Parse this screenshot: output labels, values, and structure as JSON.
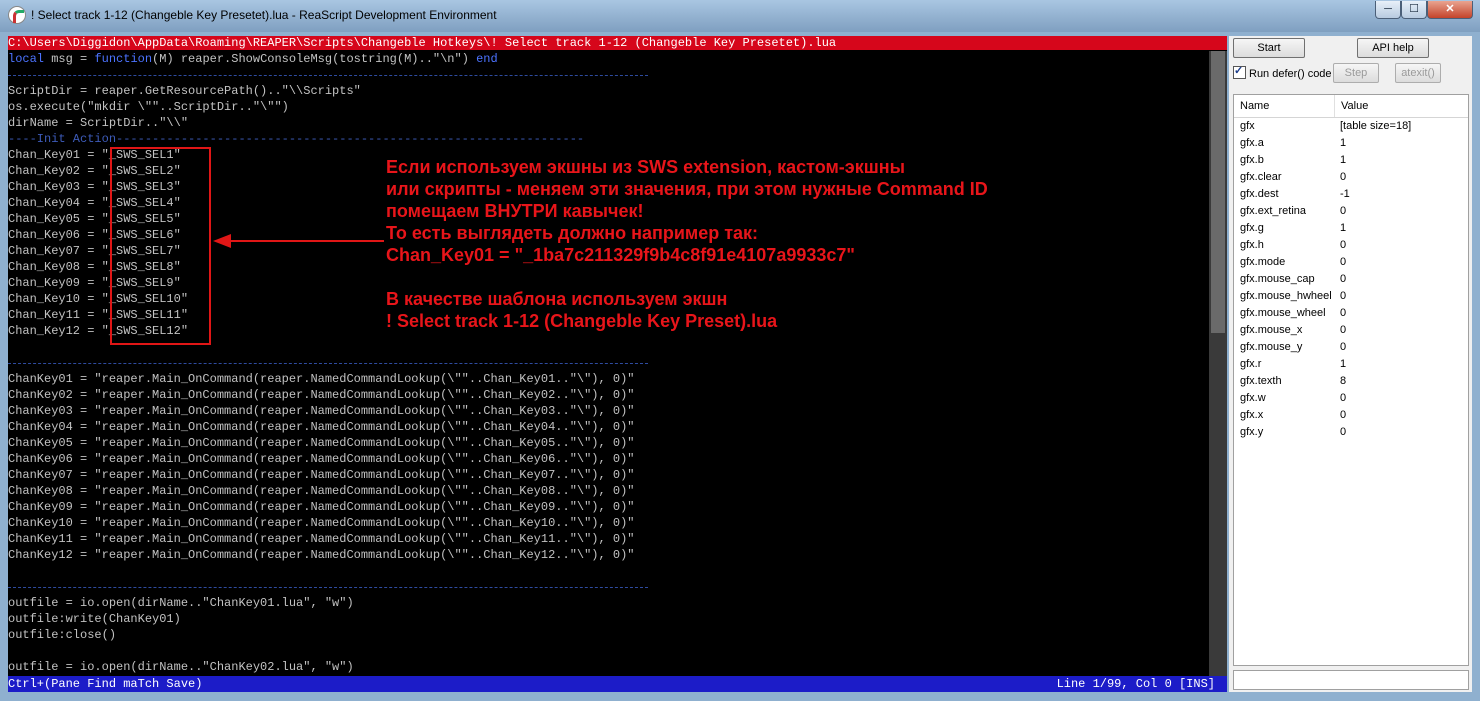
{
  "window": {
    "title": "! Select track 1-12 (Changeble Key Presetet).lua - ReaScript Development Environment",
    "min_label": "─",
    "max_label": "☐",
    "close_label": "✕"
  },
  "editor": {
    "filepath": "C:\\Users\\Diggidon\\AppData\\Roaming\\REAPER\\Scripts\\Changeble Hotkeys\\! Select track 1-12 (Changeble Key Presetet).lua",
    "status_left": "Ctrl+(Pane Find maTch Save)",
    "status_right": "Line 1/99, Col 0 [INS]",
    "code": {
      "l1_kw1": "local",
      "l1_mid": " msg = ",
      "l1_kw2": "function",
      "l1_rest": "(M) reaper.ShowConsoleMsg(tostring(M)..\"\\n\") ",
      "l1_kw3": "end",
      "block1": [
        "ScriptDir = reaper.GetResourcePath()..\"\\\\Scripts\"",
        "os.execute(\"mkdir \\\"\"..ScriptDir..\"\\\"\")",
        "dirName = ScriptDir..\"\\\\\""
      ],
      "init_comment": "----Init Action-----------------------------------------------------------------",
      "chan_keys": [
        "Chan_Key01 = \"_SWS_SEL1\"",
        "Chan_Key02 = \"_SWS_SEL2\"",
        "Chan_Key03 = \"_SWS_SEL3\"",
        "Chan_Key04 = \"_SWS_SEL4\"",
        "Chan_Key05 = \"_SWS_SEL5\"",
        "Chan_Key06 = \"_SWS_SEL6\"",
        "Chan_Key07 = \"_SWS_SEL7\"",
        "Chan_Key08 = \"_SWS_SEL8\"",
        "Chan_Key09 = \"_SWS_SEL9\"",
        "Chan_Key10 = \"_SWS_SEL10\"",
        "Chan_Key11 = \"_SWS_SEL11\"",
        "Chan_Key12 = \"_SWS_SEL12\""
      ],
      "commands": [
        "ChanKey01 = \"reaper.Main_OnCommand(reaper.NamedCommandLookup(\\\"\"..Chan_Key01..\"\\\"), 0)\"",
        "ChanKey02 = \"reaper.Main_OnCommand(reaper.NamedCommandLookup(\\\"\"..Chan_Key02..\"\\\"), 0)\"",
        "ChanKey03 = \"reaper.Main_OnCommand(reaper.NamedCommandLookup(\\\"\"..Chan_Key03..\"\\\"), 0)\"",
        "ChanKey04 = \"reaper.Main_OnCommand(reaper.NamedCommandLookup(\\\"\"..Chan_Key04..\"\\\"), 0)\"",
        "ChanKey05 = \"reaper.Main_OnCommand(reaper.NamedCommandLookup(\\\"\"..Chan_Key05..\"\\\"), 0)\"",
        "ChanKey06 = \"reaper.Main_OnCommand(reaper.NamedCommandLookup(\\\"\"..Chan_Key06..\"\\\"), 0)\"",
        "ChanKey07 = \"reaper.Main_OnCommand(reaper.NamedCommandLookup(\\\"\"..Chan_Key07..\"\\\"), 0)\"",
        "ChanKey08 = \"reaper.Main_OnCommand(reaper.NamedCommandLookup(\\\"\"..Chan_Key08..\"\\\"), 0)\"",
        "ChanKey09 = \"reaper.Main_OnCommand(reaper.NamedCommandLookup(\\\"\"..Chan_Key09..\"\\\"), 0)\"",
        "ChanKey10 = \"reaper.Main_OnCommand(reaper.NamedCommandLookup(\\\"\"..Chan_Key10..\"\\\"), 0)\"",
        "ChanKey11 = \"reaper.Main_OnCommand(reaper.NamedCommandLookup(\\\"\"..Chan_Key11..\"\\\"), 0)\"",
        "ChanKey12 = \"reaper.Main_OnCommand(reaper.NamedCommandLookup(\\\"\"..Chan_Key12..\"\\\"), 0)\""
      ],
      "outfile": [
        "outfile = io.open(dirName..\"ChanKey01.lua\", \"w\")",
        "outfile:write(ChanKey01)",
        "outfile:close()",
        "",
        "outfile = io.open(dirName..\"ChanKey02.lua\", \"w\")"
      ]
    }
  },
  "annotation": {
    "lines1": [
      "Если используем экшны из SWS extension, кастом-экшны",
      "или скрипты - меняем эти значения, при этом нужные Command ID",
      "помещаем ВНУТРИ кавычек!",
      "То есть выглядеть должно например так:",
      "Chan_Key01 = \"_1ba7c211329f9b4c8f91e4107a9933c7\""
    ],
    "lines2": [
      "В качестве шаблона используем экшн",
      "! Select track 1-12 (Changeble Key Preset).lua"
    ],
    "color": "#e8151a"
  },
  "panel": {
    "start_label": "Start",
    "api_help_label": "API help",
    "run_defer_label": "Run defer() code",
    "run_defer_checked": true,
    "step_label": "Step",
    "atexit_label": "atexit()",
    "col_name": "Name",
    "col_value": "Value",
    "vars": [
      {
        "name": "gfx",
        "value": "[table size=18]"
      },
      {
        "name": "gfx.a",
        "value": "1"
      },
      {
        "name": "gfx.b",
        "value": "1"
      },
      {
        "name": "gfx.clear",
        "value": "0"
      },
      {
        "name": "gfx.dest",
        "value": "-1"
      },
      {
        "name": "gfx.ext_retina",
        "value": "0"
      },
      {
        "name": "gfx.g",
        "value": "1"
      },
      {
        "name": "gfx.h",
        "value": "0"
      },
      {
        "name": "gfx.mode",
        "value": "0"
      },
      {
        "name": "gfx.mouse_cap",
        "value": "0"
      },
      {
        "name": "gfx.mouse_hwheel",
        "value": "0"
      },
      {
        "name": "gfx.mouse_wheel",
        "value": "0"
      },
      {
        "name": "gfx.mouse_x",
        "value": "0"
      },
      {
        "name": "gfx.mouse_y",
        "value": "0"
      },
      {
        "name": "gfx.r",
        "value": "1"
      },
      {
        "name": "gfx.texth",
        "value": "8"
      },
      {
        "name": "gfx.w",
        "value": "0"
      },
      {
        "name": "gfx.x",
        "value": "0"
      },
      {
        "name": "gfx.y",
        "value": "0"
      }
    ]
  }
}
